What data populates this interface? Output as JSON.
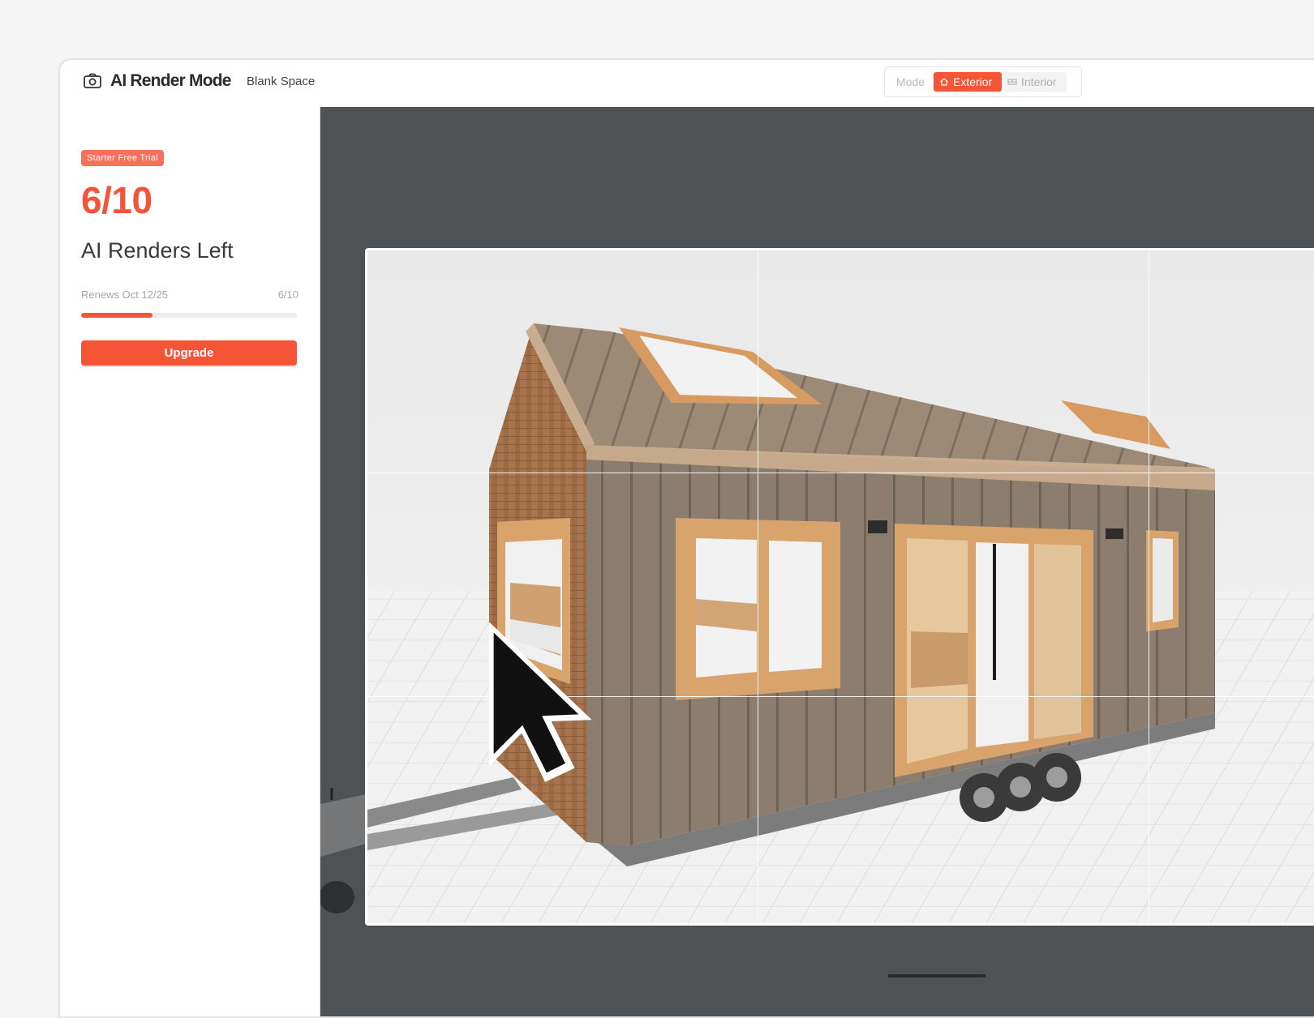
{
  "header": {
    "title": "AI Render Mode",
    "project_name": "Blank Space",
    "mode": {
      "label": "Mode",
      "options": [
        "Exterior",
        "Interior"
      ],
      "selected": "Exterior"
    },
    "icons": {
      "app": "camera-icon",
      "exterior": "house-icon",
      "interior": "layout-icon"
    }
  },
  "sidebar": {
    "plan_badge": "Starter Free Trial",
    "renders_count": "6/10",
    "renders_label": "AI Renders Left",
    "renews_text": "Renews Oct 12/25",
    "usage_text": "6/10",
    "usage_fraction": 0.33,
    "upgrade_label": "Upgrade"
  },
  "viewport": {
    "content": "tiny-house-3d-render",
    "overlay": "rule-of-thirds-grid",
    "cursor": "arrow-cursor-icon"
  },
  "colors": {
    "accent": "#f55536",
    "badge": "#f7705a",
    "viewport_bg": "#4f5254"
  }
}
